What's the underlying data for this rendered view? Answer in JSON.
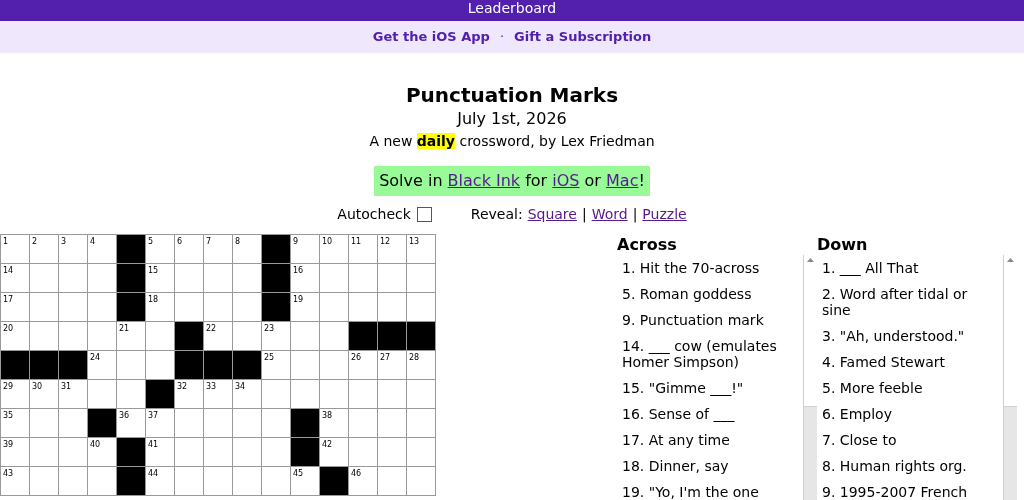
{
  "top_bar": {
    "label": "Leaderboard"
  },
  "promo_links": [
    {
      "label": "Get the iOS App"
    },
    {
      "label": "Gift a Subscription"
    }
  ],
  "promo_separator": "·",
  "puzzle": {
    "title": "Punctuation Marks",
    "date": "July 1st, 2026",
    "byline": {
      "before": "A new ",
      "highlight": "daily",
      "after": " crossword, by Lex Friedman"
    }
  },
  "banner": {
    "parts": [
      {
        "kind": "text",
        "text": "Solve in "
      },
      {
        "kind": "link",
        "text": "Black Ink"
      },
      {
        "kind": "text",
        "text": " for "
      },
      {
        "kind": "link",
        "text": "iOS"
      },
      {
        "kind": "text",
        "text": " or "
      },
      {
        "kind": "link",
        "text": "Mac"
      },
      {
        "kind": "text",
        "text": "!"
      }
    ]
  },
  "autocheck": {
    "label": "Autocheck",
    "checked": false
  },
  "reveal": {
    "label": "Reveal:",
    "links": [
      "Square",
      "Word",
      "Puzzle"
    ],
    "separator": "|"
  },
  "grid": {
    "rows": [
      [
        {
          "kind": "open",
          "number": "1"
        },
        {
          "kind": "open",
          "number": "2"
        },
        {
          "kind": "open",
          "number": "3"
        },
        {
          "kind": "open",
          "number": "4"
        },
        {
          "kind": "block"
        },
        {
          "kind": "open",
          "number": "5"
        },
        {
          "kind": "open",
          "number": "6"
        },
        {
          "kind": "open",
          "number": "7"
        },
        {
          "kind": "open",
          "number": "8"
        },
        {
          "kind": "block"
        },
        {
          "kind": "open",
          "number": "9"
        },
        {
          "kind": "open",
          "number": "10"
        },
        {
          "kind": "open",
          "number": "11"
        },
        {
          "kind": "open",
          "number": "12"
        },
        {
          "kind": "open",
          "number": "13"
        }
      ],
      [
        {
          "kind": "open",
          "number": "14"
        },
        {
          "kind": "open"
        },
        {
          "kind": "open"
        },
        {
          "kind": "open"
        },
        {
          "kind": "block"
        },
        {
          "kind": "open",
          "number": "15"
        },
        {
          "kind": "open"
        },
        {
          "kind": "open"
        },
        {
          "kind": "open"
        },
        {
          "kind": "block"
        },
        {
          "kind": "open",
          "number": "16"
        },
        {
          "kind": "open"
        },
        {
          "kind": "open"
        },
        {
          "kind": "open"
        },
        {
          "kind": "open"
        }
      ],
      [
        {
          "kind": "open",
          "number": "17"
        },
        {
          "kind": "open"
        },
        {
          "kind": "open"
        },
        {
          "kind": "open"
        },
        {
          "kind": "block"
        },
        {
          "kind": "open",
          "number": "18"
        },
        {
          "kind": "open"
        },
        {
          "kind": "open"
        },
        {
          "kind": "open"
        },
        {
          "kind": "block"
        },
        {
          "kind": "open",
          "number": "19"
        },
        {
          "kind": "open"
        },
        {
          "kind": "open"
        },
        {
          "kind": "open"
        },
        {
          "kind": "open"
        }
      ],
      [
        {
          "kind": "open",
          "number": "20"
        },
        {
          "kind": "open"
        },
        {
          "kind": "open"
        },
        {
          "kind": "open"
        },
        {
          "kind": "open",
          "number": "21"
        },
        {
          "kind": "open"
        },
        {
          "kind": "block"
        },
        {
          "kind": "open",
          "number": "22"
        },
        {
          "kind": "open"
        },
        {
          "kind": "open",
          "number": "23"
        },
        {
          "kind": "open"
        },
        {
          "kind": "open"
        },
        {
          "kind": "block"
        },
        {
          "kind": "block"
        },
        {
          "kind": "block"
        }
      ],
      [
        {
          "kind": "block"
        },
        {
          "kind": "block"
        },
        {
          "kind": "block"
        },
        {
          "kind": "open",
          "number": "24"
        },
        {
          "kind": "open"
        },
        {
          "kind": "open"
        },
        {
          "kind": "block"
        },
        {
          "kind": "block"
        },
        {
          "kind": "block"
        },
        {
          "kind": "open",
          "number": "25"
        },
        {
          "kind": "open"
        },
        {
          "kind": "open"
        },
        {
          "kind": "open",
          "number": "26"
        },
        {
          "kind": "open",
          "number": "27"
        },
        {
          "kind": "open",
          "number": "28"
        }
      ],
      [
        {
          "kind": "open",
          "number": "29"
        },
        {
          "kind": "open",
          "number": "30"
        },
        {
          "kind": "open",
          "number": "31"
        },
        {
          "kind": "open"
        },
        {
          "kind": "open"
        },
        {
          "kind": "block"
        },
        {
          "kind": "open",
          "number": "32"
        },
        {
          "kind": "open",
          "number": "33"
        },
        {
          "kind": "open",
          "number": "34"
        },
        {
          "kind": "open"
        },
        {
          "kind": "open"
        },
        {
          "kind": "open"
        },
        {
          "kind": "open"
        },
        {
          "kind": "open"
        },
        {
          "kind": "open"
        }
      ],
      [
        {
          "kind": "open",
          "number": "35"
        },
        {
          "kind": "open"
        },
        {
          "kind": "open"
        },
        {
          "kind": "block"
        },
        {
          "kind": "open",
          "number": "36"
        },
        {
          "kind": "open",
          "number": "37"
        },
        {
          "kind": "open"
        },
        {
          "kind": "open"
        },
        {
          "kind": "open"
        },
        {
          "kind": "open"
        },
        {
          "kind": "block"
        },
        {
          "kind": "open",
          "number": "38"
        },
        {
          "kind": "open"
        },
        {
          "kind": "open"
        },
        {
          "kind": "open"
        }
      ],
      [
        {
          "kind": "open",
          "number": "39"
        },
        {
          "kind": "open"
        },
        {
          "kind": "open"
        },
        {
          "kind": "open",
          "number": "40"
        },
        {
          "kind": "block"
        },
        {
          "kind": "open",
          "number": "41"
        },
        {
          "kind": "open"
        },
        {
          "kind": "open"
        },
        {
          "kind": "open"
        },
        {
          "kind": "open"
        },
        {
          "kind": "block"
        },
        {
          "kind": "open",
          "number": "42"
        },
        {
          "kind": "open"
        },
        {
          "kind": "open"
        },
        {
          "kind": "open"
        }
      ],
      [
        {
          "kind": "open",
          "number": "43"
        },
        {
          "kind": "open"
        },
        {
          "kind": "open"
        },
        {
          "kind": "open"
        },
        {
          "kind": "block"
        },
        {
          "kind": "open",
          "number": "44"
        },
        {
          "kind": "open"
        },
        {
          "kind": "open"
        },
        {
          "kind": "open"
        },
        {
          "kind": "open"
        },
        {
          "kind": "open",
          "number": "45"
        },
        {
          "kind": "block"
        },
        {
          "kind": "open",
          "number": "46"
        },
        {
          "kind": "open"
        },
        {
          "kind": "open"
        }
      ]
    ]
  },
  "clues": [
    {
      "heading": "Across",
      "items": [
        "1. Hit the 70-across",
        "5. Roman goddess",
        "9. Punctuation mark",
        "14. ___ cow (emulates Homer Simpson)",
        "15. \"Gimme ___!\"",
        "16. Sense of ___",
        "17. At any time",
        "18. Dinner, say",
        "19. \"Yo, I'm the one"
      ]
    },
    {
      "heading": "Down",
      "items": [
        "1. ___ All That",
        "2. Word after tidal or sine",
        "3. \"Ah, understood.\"",
        "4. Famed Stewart",
        "5. More feeble",
        "6. Employ",
        "7. Close to",
        "8. Human rights org.",
        "9. 1995-2007 French"
      ]
    }
  ]
}
